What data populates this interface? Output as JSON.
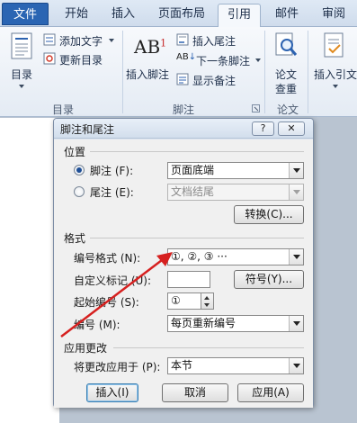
{
  "ribbon_tabs": {
    "file": "文件",
    "home": "开始",
    "insert": "插入",
    "page_layout": "页面布局",
    "references": "引用",
    "mailings": "邮件",
    "review": "审阅"
  },
  "ribbon": {
    "toc": {
      "button": "目录",
      "add_text": "添加文字",
      "update_toc": "更新目录",
      "group_label": "目录"
    },
    "footnotes": {
      "insert_footnote": "插入脚注",
      "insert_endnote": "插入尾注",
      "next_footnote": "下一条脚注",
      "show_notes": "显示备注",
      "group_label": "脚注",
      "ab_glyph": "AB",
      "ab_sup": "1",
      "next_ab_glyph": "AB"
    },
    "citations": {
      "paper_check_line1": "论文",
      "paper_check_line2": "查重",
      "group_label": "论文"
    },
    "insert_citation": "插入引文"
  },
  "dialog": {
    "title": "脚注和尾注",
    "help": "?",
    "close": "✕",
    "location_section": "位置",
    "footnote_label": "脚注 (F):",
    "footnote_value": "页面底端",
    "endnote_label": "尾注 (E):",
    "endnote_value": "文档结尾",
    "convert_button": "转换(C)...",
    "format_section": "格式",
    "number_format_label": "编号格式 (N):",
    "number_format_value": "①, ②, ③ ···",
    "custom_mark_label": "自定义标记 (U):",
    "custom_mark_value": "",
    "symbol_button": "符号(Y)...",
    "start_at_label": "起始编号 (S):",
    "start_at_value": "①",
    "numbering_label": "编号 (M):",
    "numbering_value": "每页重新编号",
    "apply_section": "应用更改",
    "apply_to_label": "将更改应用于 (P):",
    "apply_to_value": "本节",
    "insert_button": "插入(I)",
    "cancel_button": "取消",
    "apply_button": "应用(A)"
  },
  "colors": {
    "annotation_arrow": "#d6201f",
    "file_tab": "#2a65b3"
  }
}
